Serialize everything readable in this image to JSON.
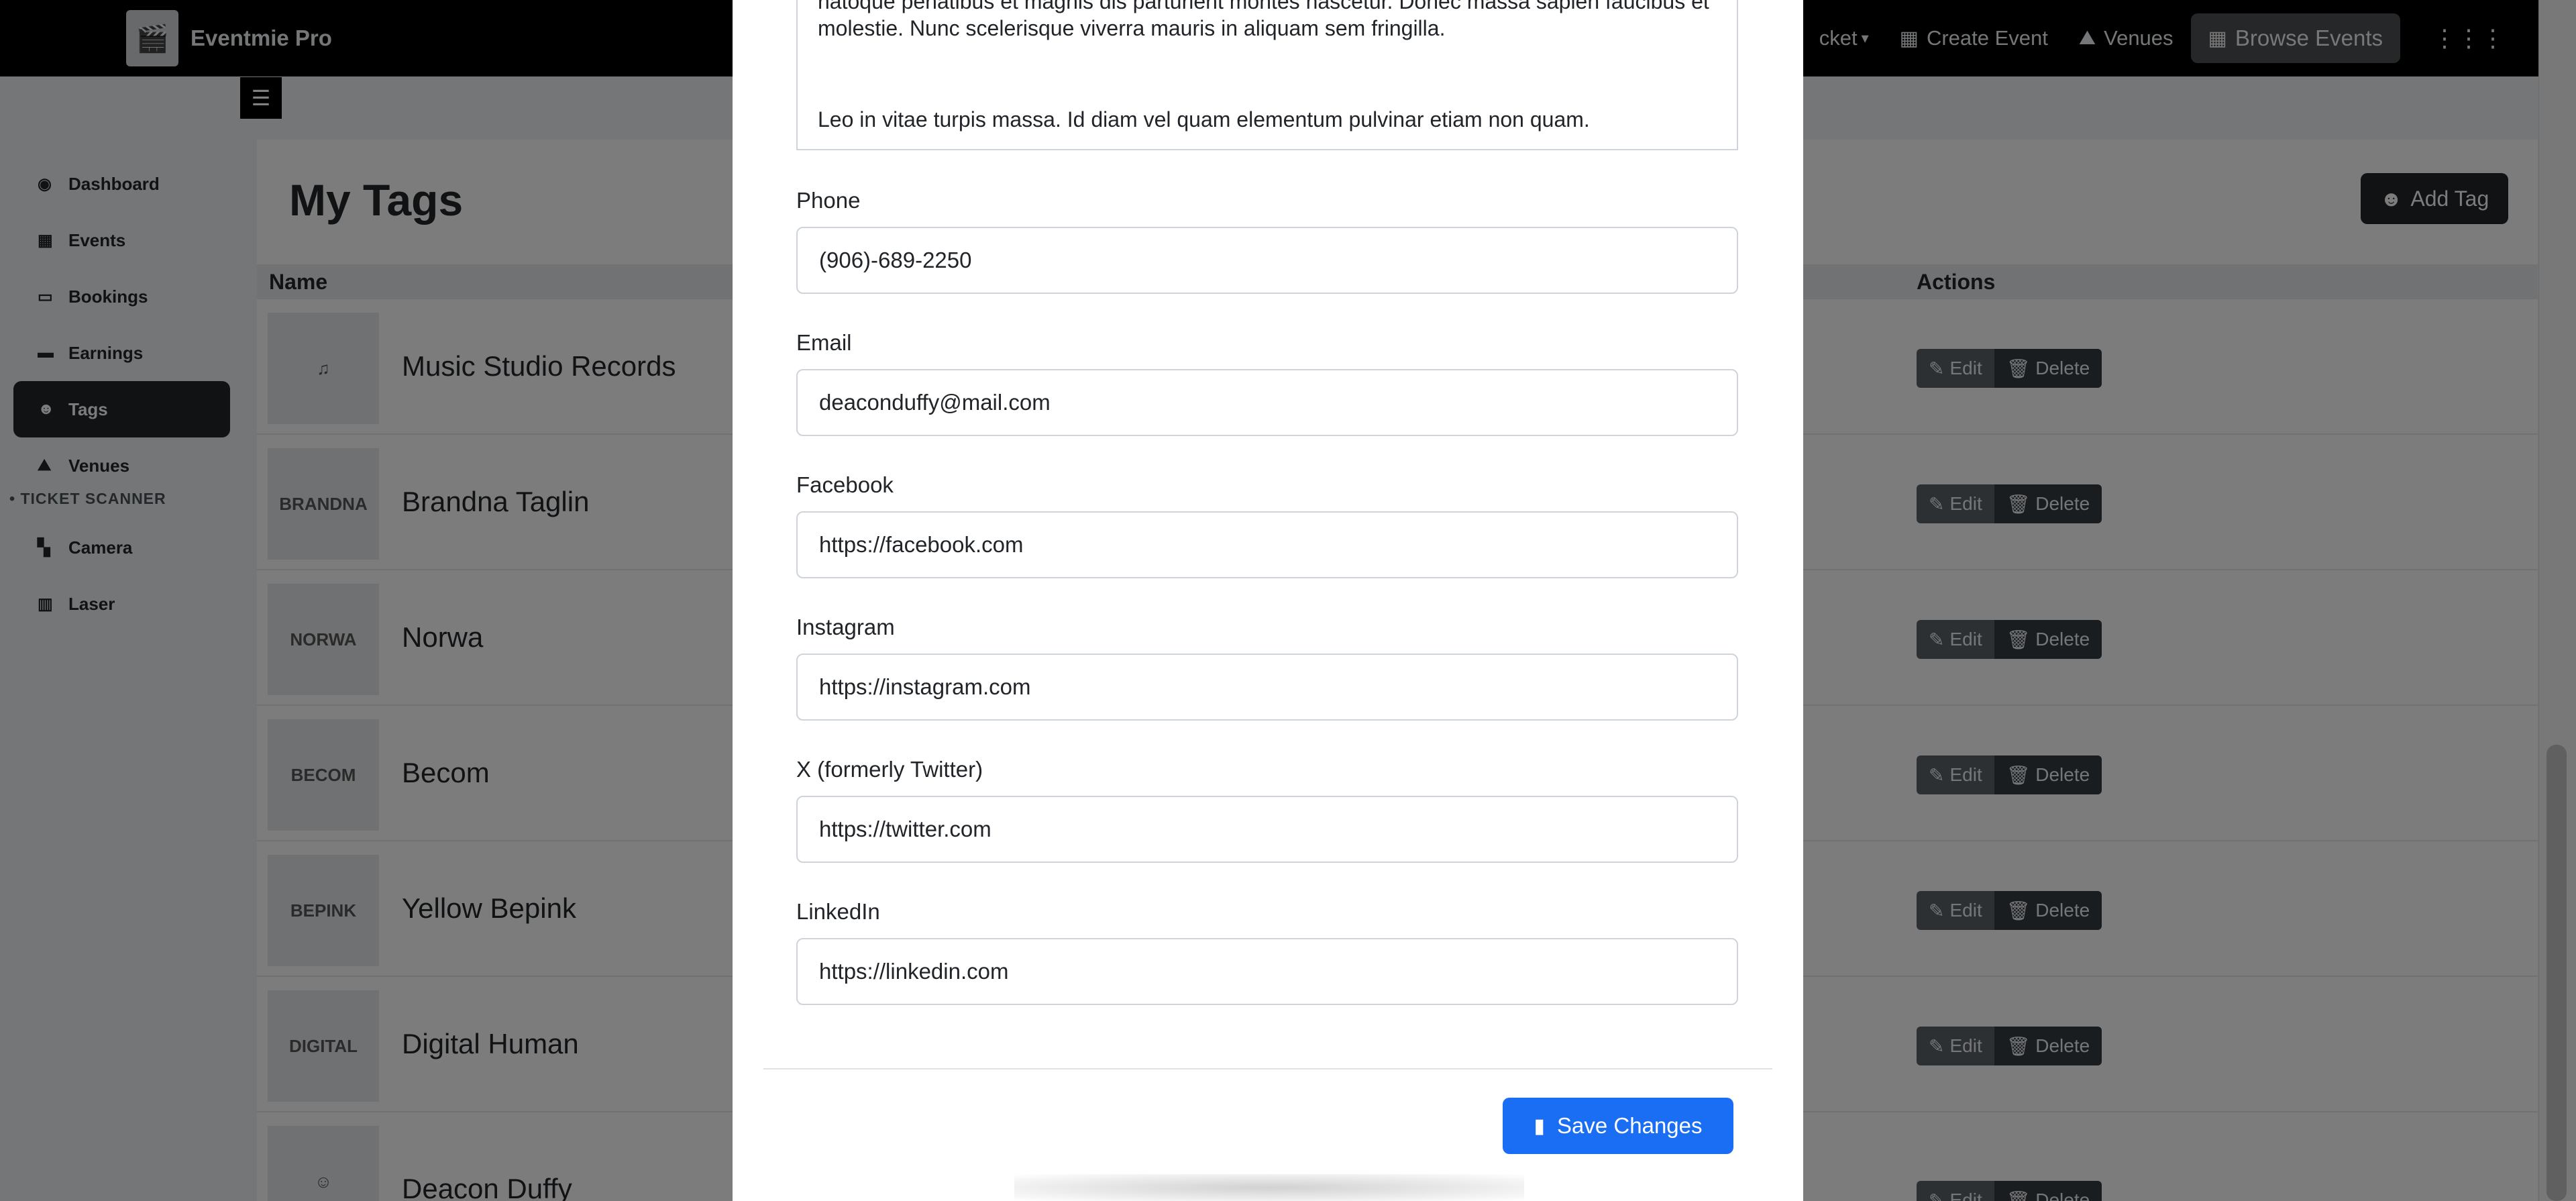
{
  "navbar": {
    "brand": "Eventmie Pro",
    "items": [
      {
        "label": "cket",
        "icon": "caret-down-icon"
      },
      {
        "label": "Create Event",
        "icon": "calendar-plus-icon"
      },
      {
        "label": "Venues",
        "icon": "map-icon"
      },
      {
        "label": "Browse Events",
        "icon": "calendar-icon"
      }
    ]
  },
  "sidebar": {
    "items": [
      {
        "label": "Dashboard"
      },
      {
        "label": "Events"
      },
      {
        "label": "Bookings"
      },
      {
        "label": "Earnings"
      },
      {
        "label": "Tags"
      },
      {
        "label": "Venues"
      }
    ],
    "scanner_heading": "TICKET SCANNER",
    "scanner_items": [
      {
        "label": "Camera"
      },
      {
        "label": "Laser"
      }
    ]
  },
  "page": {
    "title": "My Tags",
    "add_label": "Add Tag",
    "columns": {
      "name": "Name",
      "actions": "Actions"
    },
    "edit_label": "Edit",
    "delete_label": "Delete",
    "rows": [
      {
        "name": "Music Studio Records"
      },
      {
        "name": "Brandna Taglin",
        "logo_text": "BRANDNA"
      },
      {
        "name": "Norwa",
        "logo_text": "NORWA"
      },
      {
        "name": "Becom",
        "logo_text": "BECOM"
      },
      {
        "name": "Yellow Bepink",
        "logo_text": "BEPINK"
      },
      {
        "name": "Digital Human",
        "logo_text": "DIGITAL"
      },
      {
        "name": "Deacon Duffy"
      }
    ]
  },
  "modal": {
    "description_lines": [
      "natoque penatibus et magnis dis parturient montes nascetur. Donec massa sapien faucibus et",
      "molestie. Nunc scelerisque viverra mauris in aliquam sem fringilla.",
      "Leo in vitae turpis massa. Id diam vel quam elementum pulvinar etiam non quam."
    ],
    "fields": {
      "phone": {
        "label": "Phone",
        "value": "(906)-689-2250"
      },
      "email": {
        "label": "Email",
        "value": "deaconduffy@mail.com"
      },
      "facebook": {
        "label": "Facebook",
        "value": "https://facebook.com"
      },
      "instagram": {
        "label": "Instagram",
        "value": "https://instagram.com"
      },
      "twitter": {
        "label": "X (formerly Twitter)",
        "value": "https://twitter.com"
      },
      "linkedin": {
        "label": "LinkedIn",
        "value": "https://linkedin.com"
      }
    },
    "save_label": "Save Changes"
  },
  "colors": {
    "navbar_bg": "#000000",
    "primary_button": "#1a6ef4",
    "active_sidebar_bg": "#212529",
    "overlay": "rgba(0,0,0,0.5)"
  }
}
